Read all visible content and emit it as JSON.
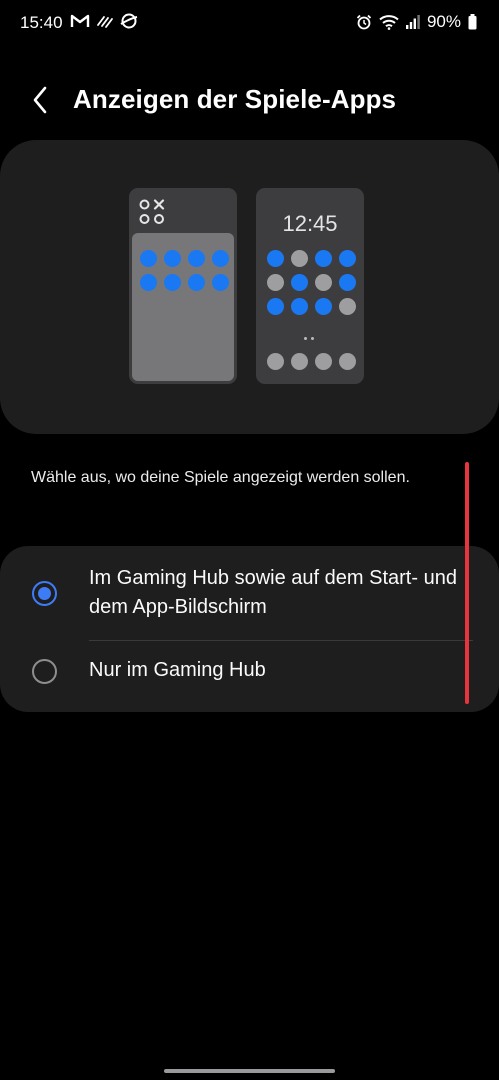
{
  "status_bar": {
    "time": "15:40",
    "left_icons": [
      "gmail-icon",
      "link-icon",
      "saturn-icon"
    ],
    "right_icons": [
      "alarm-icon",
      "wifi-icon",
      "signal-icon",
      "battery-icon"
    ],
    "battery": "90%"
  },
  "header": {
    "back_icon": "chevron-left-icon",
    "title": "Anzeigen der Spiele-Apps"
  },
  "preview": {
    "left_phone": {
      "icon": "gaming-hub-icon",
      "rows": [
        [
          "blue",
          "blue",
          "blue",
          "blue"
        ],
        [
          "blue",
          "blue",
          "blue",
          "blue"
        ]
      ]
    },
    "right_phone": {
      "clock": "12:45",
      "rows": [
        [
          "blue",
          "grey",
          "blue",
          "blue"
        ],
        [
          "grey",
          "blue",
          "grey",
          "blue"
        ],
        [
          "blue",
          "blue",
          "blue",
          "grey"
        ]
      ],
      "dock": [
        "grey",
        "grey",
        "grey",
        "grey"
      ]
    }
  },
  "description": "Wähle aus, wo deine Spiele angezeigt werden sollen.",
  "options": [
    {
      "label": "Im Gaming Hub sowie auf dem Start- und dem App-Bildschirm",
      "selected": true
    },
    {
      "label": "Nur im Gaming Hub",
      "selected": false
    }
  ],
  "colors": {
    "accent": "#3e7cf6",
    "app_blue": "#1a79f2",
    "app_grey": "#9e9ea0",
    "card": "#1e1e1f",
    "annotation": "#e8343c"
  }
}
